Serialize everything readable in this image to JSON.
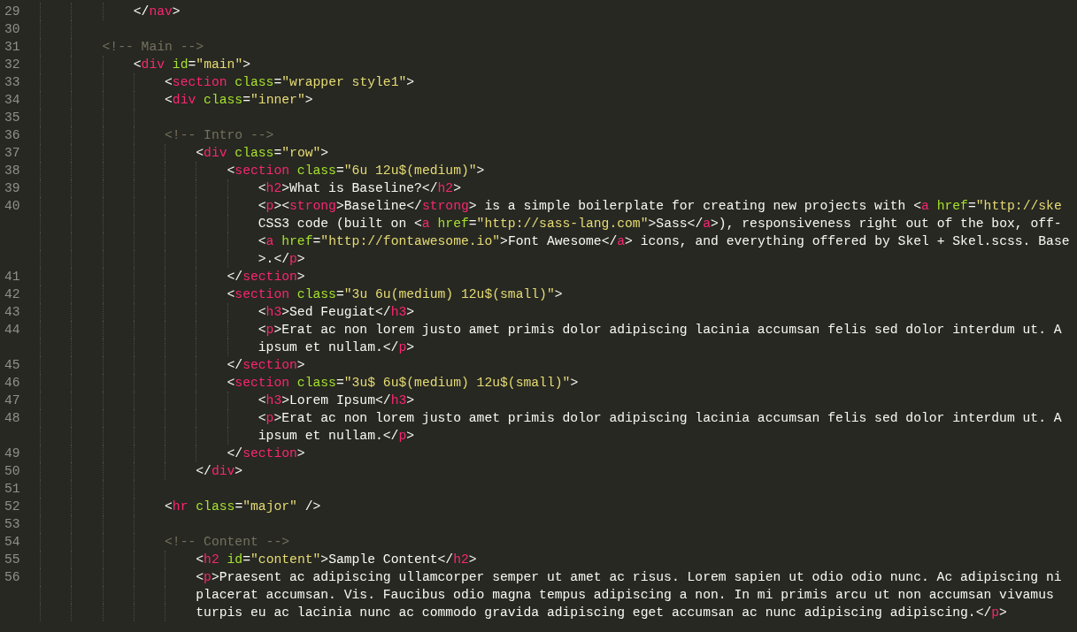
{
  "editor": {
    "lines": [
      {
        "number": "29",
        "rows": [
          "            </nav>"
        ]
      },
      {
        "number": "30"
      },
      {
        "number": "31",
        "rows": [
          "        <!-- Main -->"
        ]
      },
      {
        "number": "32",
        "rows": [
          "            <div id=\"main\">"
        ]
      },
      {
        "number": "33",
        "rows": [
          "                <section class=\"wrapper style1\">"
        ]
      },
      {
        "number": "34",
        "rows": [
          "                <div class=\"inner\">"
        ]
      },
      {
        "number": "35"
      },
      {
        "number": "36",
        "rows": [
          "                <!-- Intro -->"
        ]
      },
      {
        "number": "37",
        "rows": [
          "                    <div class=\"row\">"
        ]
      },
      {
        "number": "38",
        "rows": [
          "                        <section class=\"6u 12u$(medium)\">"
        ]
      },
      {
        "number": "39",
        "rows": [
          "                            <h2>What is Baseline?</h2>"
        ]
      },
      {
        "number": "40",
        "rows": [
          "                            <p><strong>Baseline</strong> is a simple boilerplate for creating new projects with <a href=\"http://ske",
          "                            CSS3 code (built on <a href=\"http://sass-lang.com\">Sass</a>), responsiveness right out of the box, off-",
          "                            <a href=\"http://fontawesome.io\">Font Awesome</a> icons, and everything offered by Skel + Skel.scss. Base",
          "                            >.</p>"
        ]
      },
      {
        "number": "41",
        "rows": [
          "                        </section>"
        ]
      },
      {
        "number": "42",
        "rows": [
          "                        <section class=\"3u 6u(medium) 12u$(small)\">"
        ]
      },
      {
        "number": "43",
        "rows": [
          "                            <h3>Sed Feugiat</h3>"
        ]
      },
      {
        "number": "44",
        "rows": [
          "                            <p>Erat ac non lorem justo amet primis dolor adipiscing lacinia accumsan felis sed dolor interdum ut. A",
          "                            ipsum et nullam.</p>"
        ]
      },
      {
        "number": "45",
        "rows": [
          "                        </section>"
        ]
      },
      {
        "number": "46",
        "rows": [
          "                        <section class=\"3u$ 6u$(medium) 12u$(small)\">"
        ]
      },
      {
        "number": "47",
        "rows": [
          "                            <h3>Lorem Ipsum</h3>"
        ]
      },
      {
        "number": "48",
        "rows": [
          "                            <p>Erat ac non lorem justo amet primis dolor adipiscing lacinia accumsan felis sed dolor interdum ut. A",
          "                            ipsum et nullam.</p>"
        ]
      },
      {
        "number": "49",
        "rows": [
          "                        </section>"
        ]
      },
      {
        "number": "50",
        "rows": [
          "                    </div>"
        ]
      },
      {
        "number": "51"
      },
      {
        "number": "52",
        "rows": [
          "                <hr class=\"major\" />"
        ]
      },
      {
        "number": "53"
      },
      {
        "number": "54",
        "rows": [
          "                <!-- Content -->"
        ]
      },
      {
        "number": "55",
        "rows": [
          "                    <h2 id=\"content\">Sample Content</h2>"
        ]
      },
      {
        "number": "56",
        "rows": [
          "                    <p>Praesent ac adipiscing ullamcorper semper ut amet ac risus. Lorem sapien ut odio odio nunc. Ac adipiscing ni",
          "                    placerat accumsan. Vis. Faucibus odio magna tempus adipiscing a non. In mi primis arcu ut non accumsan vivamus",
          "                    turpis eu ac lacinia nunc ac commodo gravida adipiscing eget accumsan ac nunc adipiscing adipiscing.</p>"
        ]
      }
    ]
  }
}
